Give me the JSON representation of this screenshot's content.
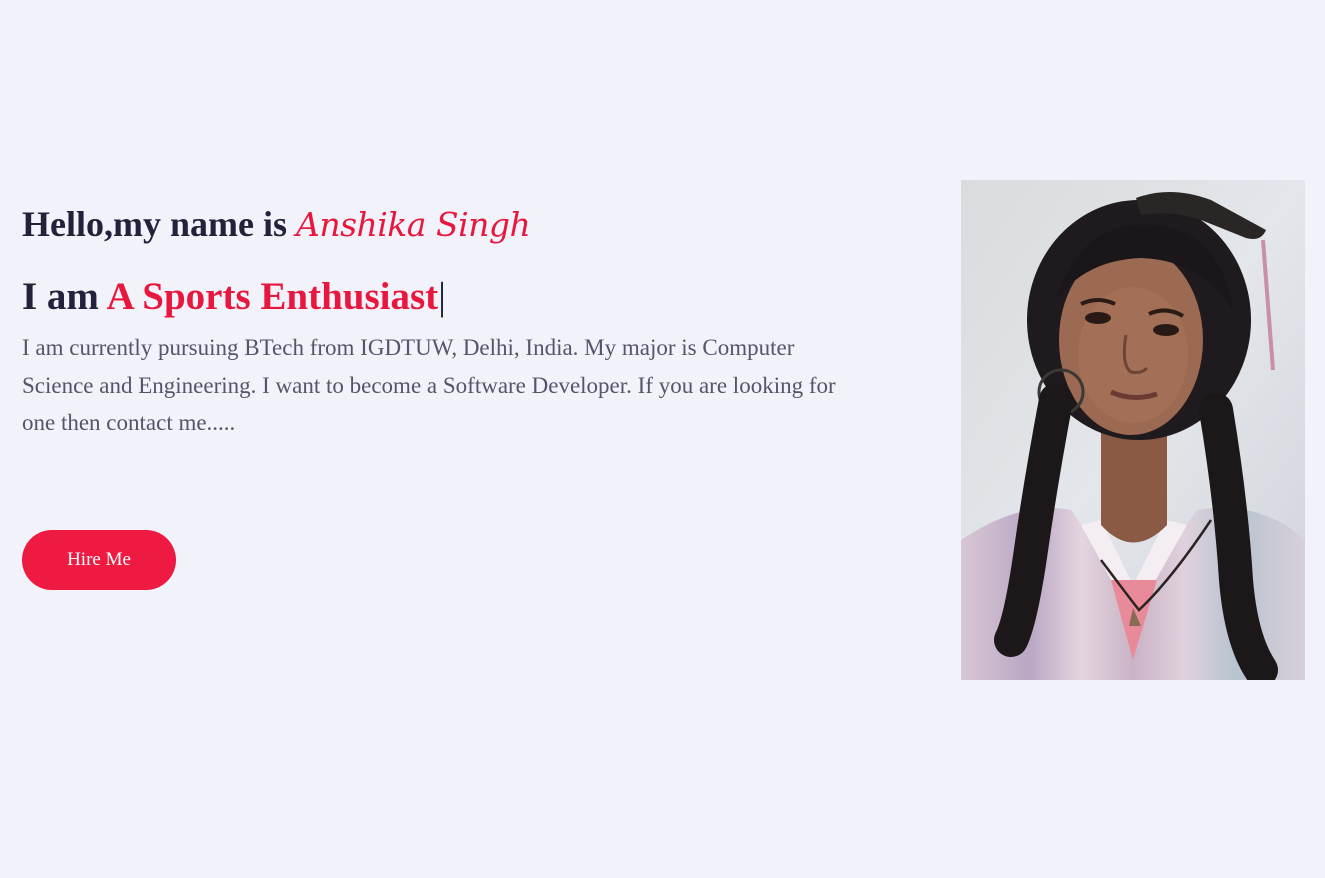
{
  "hero": {
    "greeting_prefix": "Hello,my name is",
    "name": "Anshika Singh",
    "role_prefix": "I am",
    "role": "A Sports Enthusiast",
    "cursor": "|",
    "intro": "I am currently pursuing BTech from IGDTUW, Delhi, India. My major is Computer Science and Engineering. I want to become a Software Developer. If you are looking for one then contact me.....",
    "hire_button_label": "Hire Me"
  },
  "colors": {
    "background": "#f2f2fb",
    "accent": "#e8173e",
    "heading": "#22223b",
    "body_text": "#54546a"
  }
}
